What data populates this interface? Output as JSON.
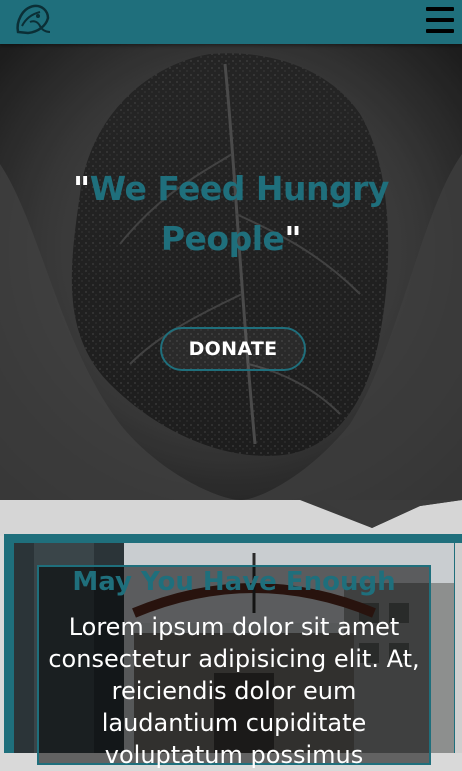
{
  "header": {
    "logo": "leaf-bird-logo-icon",
    "menu_icon": "hamburger-menu-icon",
    "bg_color": "#1f6f7c"
  },
  "hero": {
    "quote_open": "\"",
    "title": "We Feed Hungry People",
    "quote_close": "\"",
    "donate_label": "DONATE",
    "accent_color": "#1f6f7c"
  },
  "card": {
    "title": "May You Have Enough",
    "body": "Lorem ipsum dolor sit amet consectetur adipisicing elit. At, reiciendis dolor eum laudantium cupiditate voluptatum possimus"
  }
}
